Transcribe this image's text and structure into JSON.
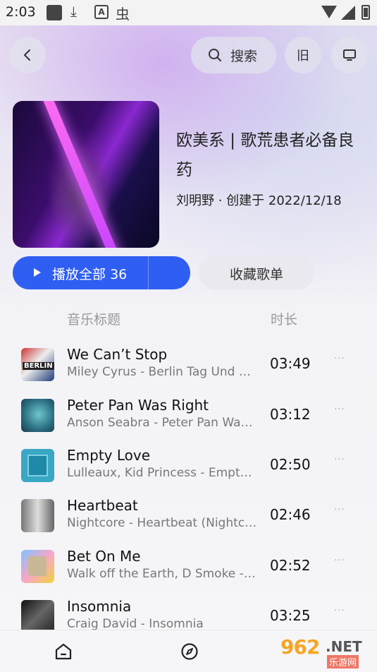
{
  "status_bar": {
    "time": "2:03",
    "icons": [
      "notification-square-icon",
      "download-icon",
      "text-a-icon",
      "bug-icon",
      "wifi-icon",
      "signal-icon",
      "battery-icon"
    ]
  },
  "top_nav": {
    "search_label": "搜索",
    "old_label": "旧"
  },
  "playlist": {
    "title": "欧美系 | 歌荒患者必备良药",
    "creator": "刘明野",
    "created_text": "· 创建于 2022/12/18"
  },
  "actions": {
    "play_all_label": "播放全部",
    "play_all_count": "36",
    "favorite_label": "收藏歌单",
    "accent_color": "#2f5ef2"
  },
  "list_header": {
    "title_col": "音乐标题",
    "duration_col": "时长"
  },
  "songs": [
    {
      "name": "We Can’t Stop",
      "subtitle": "Miley Cyrus - Berlin Tag Und Nacht",
      "duration": "03:49",
      "thumb_text": "BERLIN"
    },
    {
      "name": "Peter Pan Was Right",
      "subtitle": "Anson Seabra - Peter Pan Was Right",
      "duration": "03:12"
    },
    {
      "name": "Empty Love",
      "subtitle": "Lulleaux, Kid Princess - Empty Love",
      "duration": "02:50"
    },
    {
      "name": "Heartbeat",
      "subtitle": "Nightcore - Heartbeat (Nightcore)",
      "duration": "02:46"
    },
    {
      "name": "Bet On Me",
      "subtitle": "Walk off the Earth, D Smoke - Bet On Me",
      "duration": "02:52"
    },
    {
      "name": "Insomnia",
      "subtitle": "Craig David - Insomnia",
      "duration": "03:25"
    }
  ],
  "more_label": "···",
  "watermark": {
    "number": "962",
    "suffix": ".NET",
    "cn": "乐游网"
  }
}
